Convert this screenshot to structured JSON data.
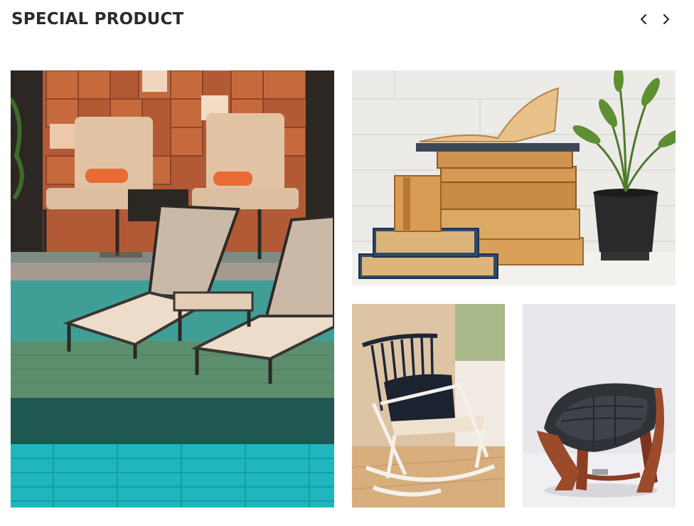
{
  "section": {
    "title": "SPECIAL PRODUCT"
  },
  "carousel_nav": {
    "prev_icon": "chevron-left-icon",
    "next_icon": "chevron-right-icon",
    "icon_color": "#2b2b2b"
  },
  "products": [
    {
      "name": "poolside-loungers-image"
    },
    {
      "name": "stacked-books-plant-image"
    },
    {
      "name": "white-rocking-chair-image"
    },
    {
      "name": "black-leather-lounge-chair-image"
    }
  ]
}
